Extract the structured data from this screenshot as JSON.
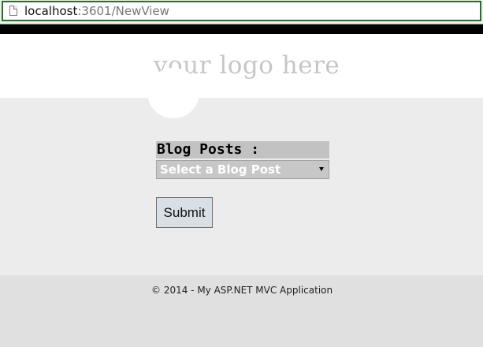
{
  "browser": {
    "url_host": "localhost",
    "url_rest": ":3601/NewView",
    "page_icon": "page-icon"
  },
  "header": {
    "logo_text": "your logo here"
  },
  "form": {
    "posts_label": "Blog Posts :",
    "select_value": "Select a Blog Post",
    "submit_label": "Submit"
  },
  "footer": {
    "copyright": "© 2014 - My ASP.NET MVC Application"
  },
  "colors": {
    "url_border": "#2e6b30",
    "header_bg": "#ffffff",
    "main_bg": "#ececec",
    "footer_bg": "#e0e0e0",
    "button_bg": "#d8e0e6"
  }
}
